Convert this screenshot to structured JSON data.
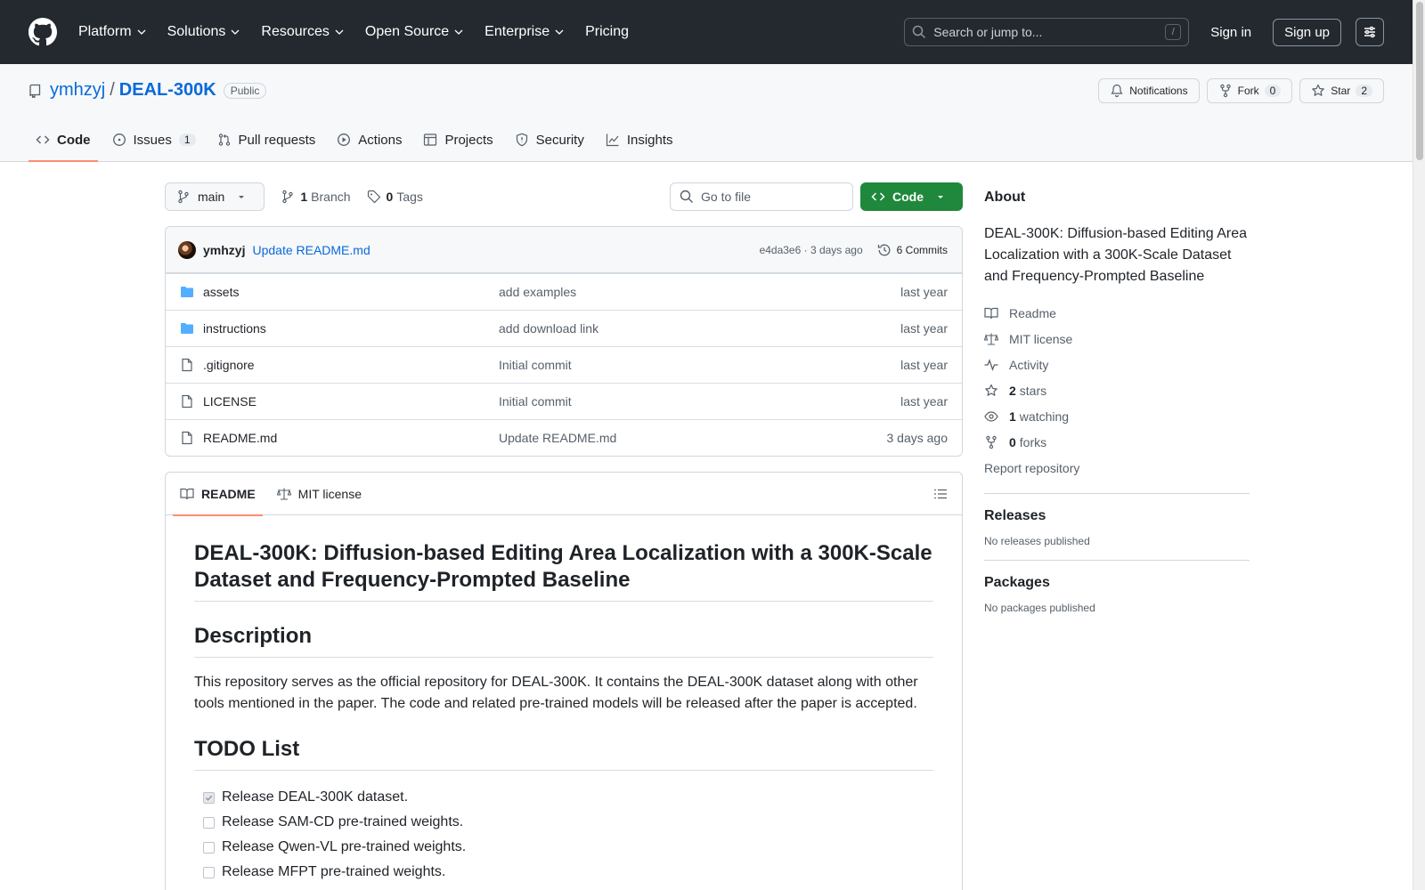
{
  "topbar": {
    "nav": [
      "Platform",
      "Solutions",
      "Resources",
      "Open Source",
      "Enterprise",
      "Pricing"
    ],
    "search_placeholder": "Search or jump to...",
    "search_shortcut": "/",
    "signin": "Sign in",
    "signup": "Sign up"
  },
  "repo": {
    "owner": "ymhzyj",
    "separator": "/",
    "name": "DEAL-300K",
    "visibility": "Public",
    "notifications": "Notifications",
    "fork_label": "Fork",
    "fork_count": "0",
    "star_label": "Star",
    "star_count": "2"
  },
  "tabs": [
    {
      "label": "Code"
    },
    {
      "label": "Issues",
      "count": "1"
    },
    {
      "label": "Pull requests"
    },
    {
      "label": "Actions"
    },
    {
      "label": "Projects"
    },
    {
      "label": "Security"
    },
    {
      "label": "Insights"
    }
  ],
  "toolbar": {
    "branch": "main",
    "branch_count": "1",
    "branch_label": "Branch",
    "tag_count": "0",
    "tag_label": "Tags",
    "goto_placeholder": "Go to file",
    "code_button": "Code"
  },
  "commit": {
    "author": "ymhzyj",
    "message": "Update README.md",
    "sha_time": "e4da3e6 · 3 days ago",
    "commits": "6 Commits"
  },
  "files": [
    {
      "name": "assets",
      "type": "folder",
      "message": "add examples",
      "date": "last year"
    },
    {
      "name": "instructions",
      "type": "folder",
      "message": "add download link",
      "date": "last year"
    },
    {
      "name": ".gitignore",
      "type": "file",
      "message": "Initial commit",
      "date": "last year"
    },
    {
      "name": "LICENSE",
      "type": "file",
      "message": "Initial commit",
      "date": "last year"
    },
    {
      "name": "README.md",
      "type": "file",
      "message": "Update README.md",
      "date": "3 days ago"
    }
  ],
  "readme": {
    "tab_readme": "README",
    "tab_license": "MIT license",
    "title": "DEAL-300K: Diffusion-based Editing Area Localization with a 300K-Scale Dataset and Frequency-Prompted Baseline",
    "h_description": "Description",
    "description": "This repository serves as the official repository for DEAL-300K. It contains the DEAL-300K dataset along with other tools mentioned in the paper. The code and related pre-trained models will be released after the paper is accepted.",
    "h_todo": "TODO List",
    "todo": [
      {
        "text": "Release DEAL-300K dataset.",
        "done": true
      },
      {
        "text": "Release SAM-CD pre-trained weights.",
        "done": false
      },
      {
        "text": "Release Qwen-VL pre-trained weights.",
        "done": false
      },
      {
        "text": "Release MFPT pre-trained weights.",
        "done": false
      }
    ]
  },
  "about": {
    "heading": "About",
    "description": "DEAL-300K: Diffusion-based Editing Area Localization with a 300K-Scale Dataset and Frequency-Prompted Baseline",
    "readme": "Readme",
    "license": "MIT license",
    "activity": "Activity",
    "stars_count": "2",
    "stars_label": "stars",
    "watching_count": "1",
    "watching_label": "watching",
    "forks_count": "0",
    "forks_label": "forks",
    "report": "Report repository"
  },
  "releases": {
    "heading": "Releases",
    "empty": "No releases published"
  },
  "packages": {
    "heading": "Packages",
    "empty": "No packages published"
  },
  "colors": {
    "header_bg": "#24292f",
    "link": "#0969da",
    "code_button": "#1f883d",
    "active_tab": "#fd8c73",
    "folder": "#54aeff"
  }
}
